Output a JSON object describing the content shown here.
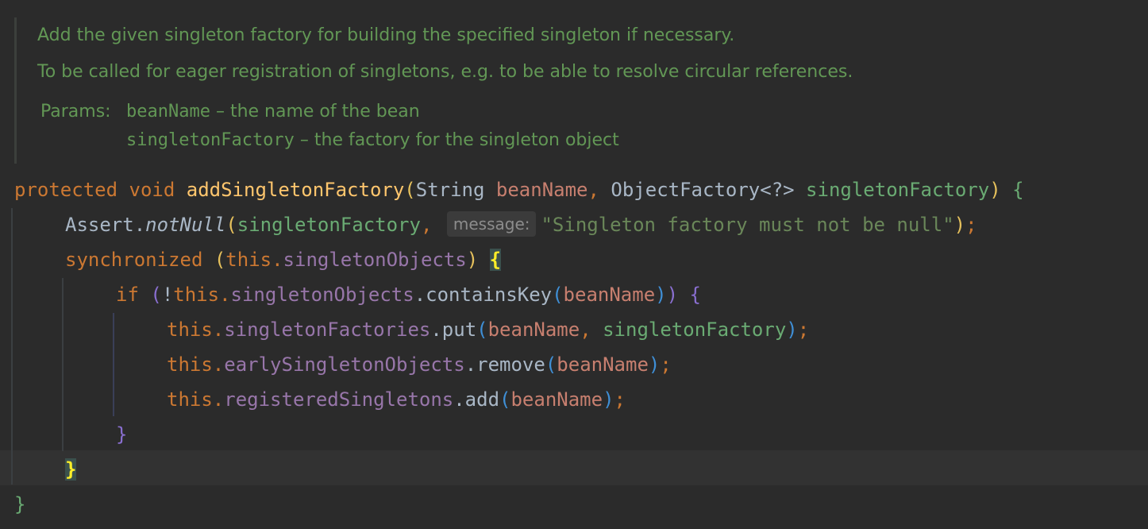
{
  "doc": {
    "line1": "Add the given singleton factory for building the specified singleton if necessary.",
    "line2": "To be called for eager registration of singletons, e.g. to be able to resolve circular references.",
    "params_label": "Params:",
    "param1_name": "beanName",
    "param1_desc": " – the name of the bean",
    "param2_name": "singletonFactory",
    "param2_desc": " – the factory for the singleton object"
  },
  "code": {
    "l1": {
      "modifier": "protected",
      "ret": "void",
      "method": "addSingletonFactory",
      "open_paren": "(",
      "type1": "String",
      "arg1": "beanName",
      "comma": ",",
      "type2": "ObjectFactory<?>",
      "arg2": "singletonFactory",
      "close_paren": ")",
      "brace": "{"
    },
    "l2": {
      "cls": "Assert.",
      "call": "notNull",
      "open": "(",
      "arg": "singletonFactory",
      "comma": ",",
      "hint": "message:",
      "str": "\"Singleton factory must not be null\"",
      "close": ")",
      "semi": ";"
    },
    "l3": {
      "kw": "synchronized",
      "open": "(",
      "this": "this.",
      "field": "singletonObjects",
      "close": ")",
      "brace": "{"
    },
    "l4": {
      "kw": "if",
      "open": "(",
      "not": "!",
      "this": "this.",
      "field": "singletonObjects",
      "call": ".containsKey",
      "open2": "(",
      "arg": "beanName",
      "close2": ")",
      "close": ")",
      "brace": "{"
    },
    "l5": {
      "this": "this.",
      "field": "singletonFactories",
      "call": ".put",
      "open": "(",
      "arg1": "beanName",
      "comma": ",",
      "arg2": "singletonFactory",
      "close": ")",
      "semi": ";"
    },
    "l6": {
      "this": "this.",
      "field": "earlySingletonObjects",
      "call": ".remove",
      "open": "(",
      "arg": "beanName",
      "close": ")",
      "semi": ";"
    },
    "l7": {
      "this": "this.",
      "field": "registeredSingletons",
      "call": ".add",
      "open": "(",
      "arg": "beanName",
      "close": ")",
      "semi": ";"
    },
    "l8": {
      "brace": "}"
    },
    "l9": {
      "brace": "}"
    },
    "l10": {
      "brace": "}"
    }
  },
  "colors": {
    "background": "#2b2b2b",
    "doc_comment": "#629755",
    "keyword": "#cc7832",
    "method": "#ffc66d",
    "field": "#9876aa",
    "string": "#6a8759",
    "param": "#c77f6f"
  }
}
